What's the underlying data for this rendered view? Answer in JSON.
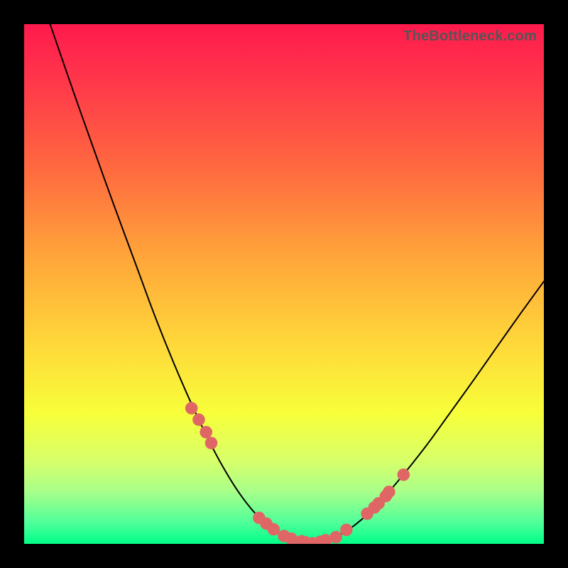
{
  "credit_text": "TheBottleneck.com",
  "chart_data": {
    "type": "line",
    "title": "",
    "xlabel": "",
    "ylabel": "",
    "xlim": [
      0,
      100
    ],
    "ylim": [
      0,
      100
    ],
    "series": [
      {
        "name": "curve-left",
        "x": [
          5.0,
          9.1,
          13.2,
          17.3,
          21.4,
          25.4,
          29.5,
          33.6,
          37.7,
          41.8,
          45.9,
          50.0,
          54.1,
          55.5
        ],
        "values": [
          100.0,
          88.1,
          76.5,
          65.1,
          54.0,
          43.2,
          33.1,
          23.9,
          15.8,
          9.2,
          4.4,
          1.5,
          0.3,
          0.1
        ]
      },
      {
        "name": "curve-right",
        "x": [
          55.5,
          59.1,
          63.6,
          68.2,
          72.7,
          77.3,
          81.8,
          86.4,
          90.9,
          95.5,
          100.0
        ],
        "values": [
          0.1,
          0.9,
          3.6,
          7.8,
          13.0,
          18.8,
          25.0,
          31.4,
          37.8,
          44.3,
          50.5
        ]
      }
    ],
    "markers": {
      "name": "highlight-dots",
      "color": "#e06666",
      "radius_pct": 1.2,
      "x": [
        32.2,
        33.6,
        35.0,
        36.0,
        45.2,
        46.6,
        48.0,
        50.0,
        51.4,
        53.4,
        54.1,
        55.5,
        57.0,
        58.0,
        60.0,
        62.0,
        66.0,
        67.4,
        68.2,
        69.6,
        70.2,
        73.0
      ],
      "values": [
        26.1,
        23.9,
        21.5,
        19.4,
        5.0,
        3.9,
        2.8,
        1.5,
        1.0,
        0.5,
        0.3,
        0.1,
        0.4,
        0.7,
        1.3,
        2.7,
        5.8,
        7.0,
        7.8,
        9.2,
        10.0,
        13.3
      ]
    }
  }
}
